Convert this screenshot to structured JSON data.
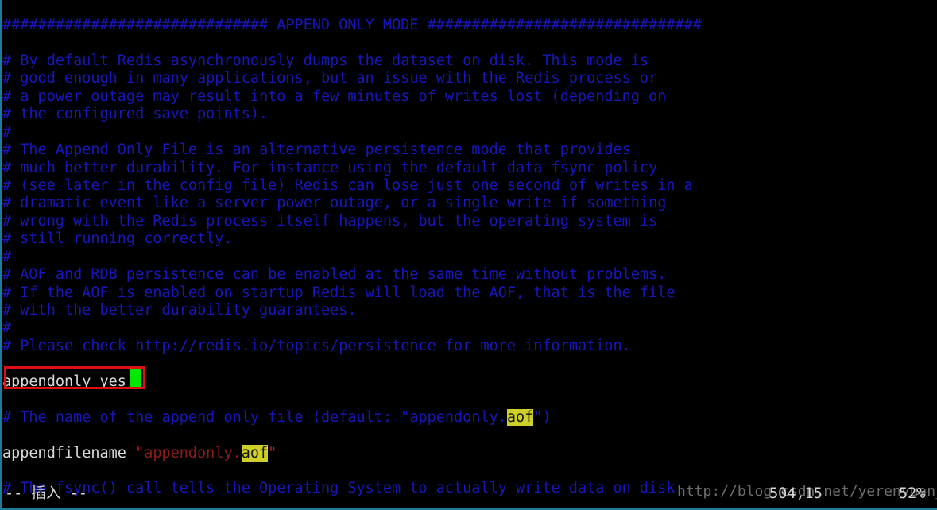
{
  "editor": {
    "name": "vim",
    "mode_label": "-- 插入 --",
    "cursor_position": "504,15",
    "scroll_percent": "52%",
    "colors": {
      "background": "#000000",
      "comment": "#1717bb",
      "plain_text": "#d9d9d9",
      "string": "#8c1c1c",
      "search_highlight_bg": "#cfcf2a",
      "search_highlight_fg": "#141414",
      "annotation_box": "#e01010",
      "cursor": "#00e800",
      "window_border": "#1f7a9c"
    },
    "search_term": "aof"
  },
  "watermark": {
    "text": "http://blog.csdn.net/yerenyuan_pku"
  },
  "lines": [
    {
      "id": "l01",
      "segments": [
        {
          "cls": "cmt",
          "text": "############################## APPEND ONLY MODE ###############################"
        }
      ]
    },
    {
      "id": "l02",
      "segments": [
        {
          "cls": "cmt",
          "text": ""
        }
      ]
    },
    {
      "id": "l03",
      "segments": [
        {
          "cls": "cmt",
          "text": "# By default Redis asynchronously dumps the dataset on disk. This mode is"
        }
      ]
    },
    {
      "id": "l04",
      "segments": [
        {
          "cls": "cmt",
          "text": "# good enough in many applications, but an issue with the Redis process or"
        }
      ]
    },
    {
      "id": "l05",
      "segments": [
        {
          "cls": "cmt",
          "text": "# a power outage may result into a few minutes of writes lost (depending on"
        }
      ]
    },
    {
      "id": "l06",
      "segments": [
        {
          "cls": "cmt",
          "text": "# the configured save points)."
        }
      ]
    },
    {
      "id": "l07",
      "segments": [
        {
          "cls": "cmt",
          "text": "#"
        }
      ]
    },
    {
      "id": "l08",
      "segments": [
        {
          "cls": "cmt",
          "text": "# The Append Only File is an alternative persistence mode that provides"
        }
      ]
    },
    {
      "id": "l09",
      "segments": [
        {
          "cls": "cmt",
          "text": "# much better durability. For instance using the default data fsync policy"
        }
      ]
    },
    {
      "id": "l10",
      "segments": [
        {
          "cls": "cmt",
          "text": "# (see later in the config file) Redis can lose just one second of writes in a"
        }
      ]
    },
    {
      "id": "l11",
      "segments": [
        {
          "cls": "cmt",
          "text": "# dramatic event like a server power outage, or a single write if something"
        }
      ]
    },
    {
      "id": "l12",
      "segments": [
        {
          "cls": "cmt",
          "text": "# wrong with the Redis process itself happens, but the operating system is"
        }
      ]
    },
    {
      "id": "l13",
      "segments": [
        {
          "cls": "cmt",
          "text": "# still running correctly."
        }
      ]
    },
    {
      "id": "l14",
      "segments": [
        {
          "cls": "cmt",
          "text": "#"
        }
      ]
    },
    {
      "id": "l15",
      "segments": [
        {
          "cls": "cmt",
          "text": "# AOF and RDB persistence can be enabled at the same time without problems."
        }
      ]
    },
    {
      "id": "l16",
      "segments": [
        {
          "cls": "cmt",
          "text": "# If the AOF is enabled on startup Redis will load the AOF, that is the file"
        }
      ]
    },
    {
      "id": "l17",
      "segments": [
        {
          "cls": "cmt",
          "text": "# with the better durability guarantees."
        }
      ]
    },
    {
      "id": "l18",
      "segments": [
        {
          "cls": "cmt",
          "text": "#"
        }
      ]
    },
    {
      "id": "l19",
      "segments": [
        {
          "cls": "cmt",
          "text": "# Please check http://redis.io/topics/persistence for more information."
        }
      ]
    },
    {
      "id": "l20",
      "segments": [
        {
          "cls": "cmt",
          "text": ""
        }
      ]
    },
    {
      "id": "l21",
      "segments": [
        {
          "cls": "plain",
          "text": "appendonly yes"
        }
      ]
    },
    {
      "id": "l22",
      "segments": [
        {
          "cls": "cmt",
          "text": ""
        }
      ]
    },
    {
      "id": "l23",
      "segments": [
        {
          "cls": "cmt",
          "text": "# The name of the append only file (default: \"appendonly."
        },
        {
          "cls": "hl",
          "text": "aof"
        },
        {
          "cls": "cmt",
          "text": "\")"
        }
      ]
    },
    {
      "id": "l24",
      "segments": [
        {
          "cls": "cmt",
          "text": ""
        }
      ]
    },
    {
      "id": "l25",
      "segments": [
        {
          "cls": "plain",
          "text": "appendfilename "
        },
        {
          "cls": "strq",
          "text": "\""
        },
        {
          "cls": "str",
          "text": "appendonly."
        },
        {
          "cls": "hl",
          "text": "aof"
        },
        {
          "cls": "strq",
          "text": "\""
        }
      ]
    },
    {
      "id": "l26",
      "segments": [
        {
          "cls": "cmt",
          "text": ""
        }
      ]
    },
    {
      "id": "l27",
      "segments": [
        {
          "cls": "cmt",
          "text": "# The fsync() call tells the Operating System to actually write data on disk"
        }
      ]
    }
  ]
}
